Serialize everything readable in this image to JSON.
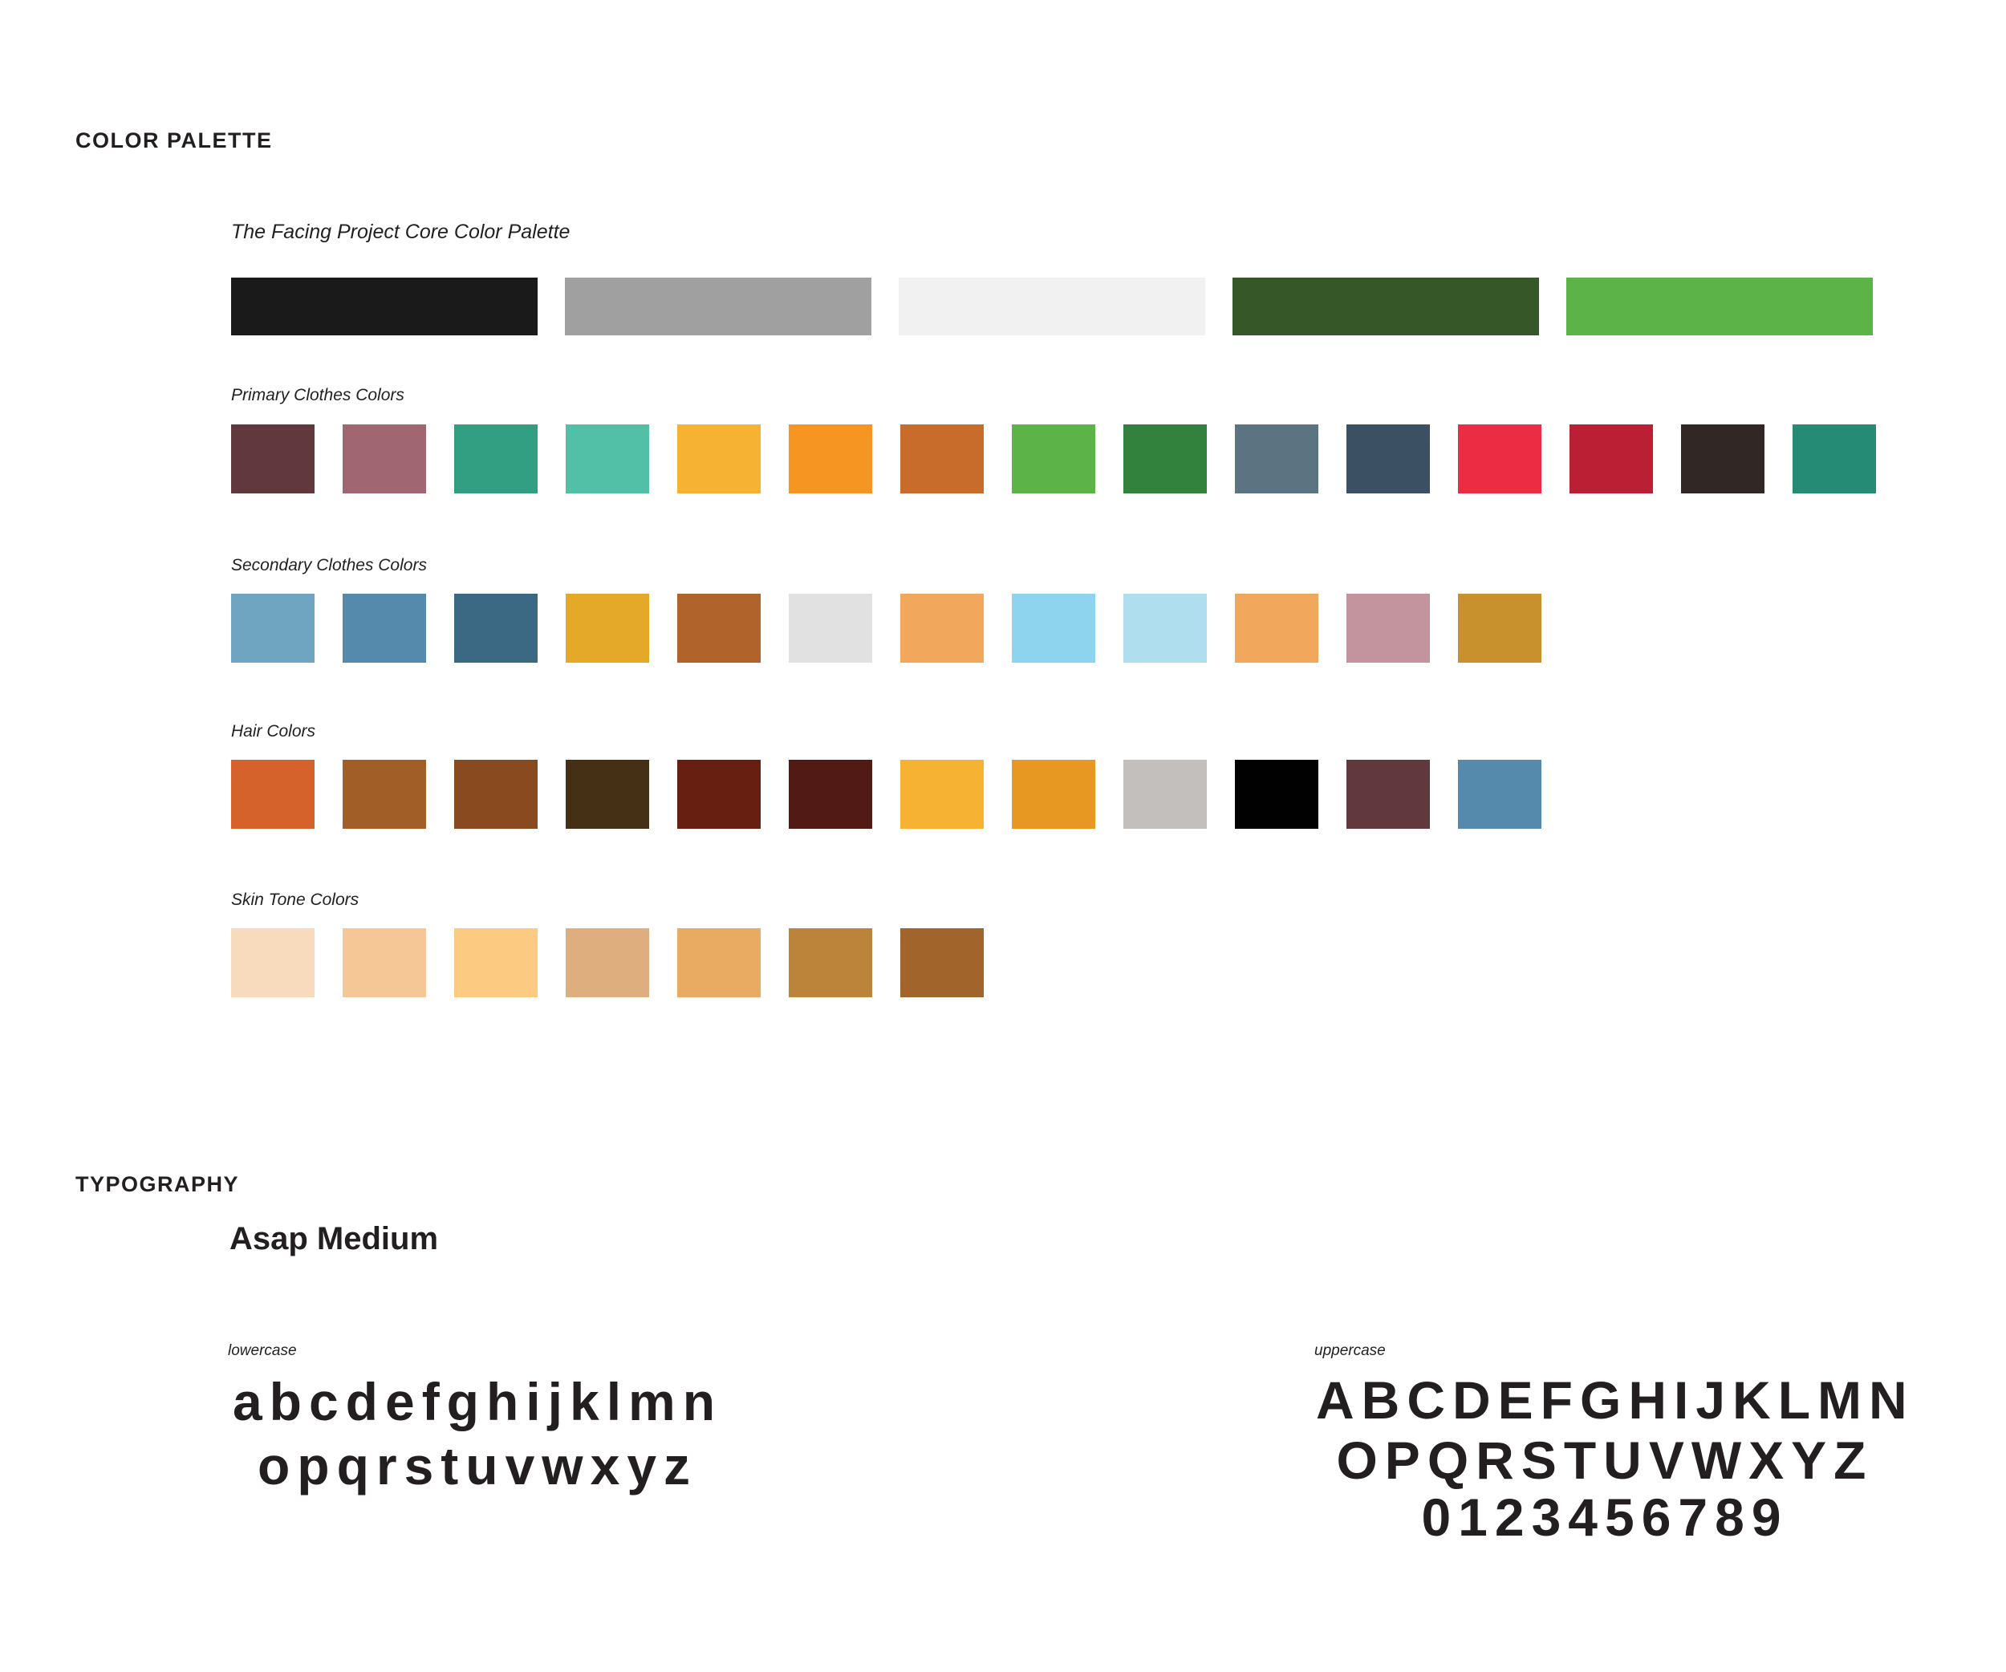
{
  "color_palette": {
    "heading": "COLOR PALETTE",
    "core": {
      "label": "The Facing Project Core Color Palette",
      "colors": [
        "#1a1a1a",
        "#a0a0a0",
        "#f1f1f1",
        "#365728",
        "#5cb347"
      ]
    },
    "primary_clothes": {
      "label": "Primary Clothes Colors",
      "colors": [
        "#62383f",
        "#a06772",
        "#339f82",
        "#52c0a7",
        "#f6b233",
        "#f69522",
        "#c76c2a",
        "#5cb347",
        "#32823d",
        "#5c7382",
        "#3b5163",
        "#eb2c43",
        "#ba1f34",
        "#312826",
        "#268b75"
      ]
    },
    "secondary_clothes": {
      "label": "Secondary Clothes Colors",
      "colors": [
        "#70a5c2",
        "#558aad",
        "#3b6882",
        "#e5a929",
        "#b0632a",
        "#e1e1e1",
        "#f1a85c",
        "#8ed4ef",
        "#afdfef",
        "#f1a85c",
        "#c3949e",
        "#c9902e"
      ]
    },
    "hair": {
      "label": "Hair Colors",
      "colors": [
        "#d4622a",
        "#a15e27",
        "#894a20",
        "#463015",
        "#671f11",
        "#521a14",
        "#f6b233",
        "#e79822",
        "#c3bfbc",
        "#010101",
        "#62383f",
        "#558aad"
      ]
    },
    "skin_tone": {
      "label": "Skin Tone Colors",
      "colors": [
        "#f7dbbc",
        "#f5c796",
        "#fcca80",
        "#dfae7f",
        "#e8ab61",
        "#bc833a",
        "#a1652c"
      ]
    }
  },
  "typography": {
    "heading": "TYPOGRAPHY",
    "font_name": "Asap Medium",
    "lowercase": {
      "label": "lowercase",
      "lines": [
        "abcdefghijklmn",
        "opqrstuvwxyz"
      ]
    },
    "uppercase": {
      "label": "uppercase",
      "lines": [
        "ABCDEFGHIJKLMN",
        "OPQRSTUVWXYZ",
        "0123456789"
      ]
    }
  }
}
